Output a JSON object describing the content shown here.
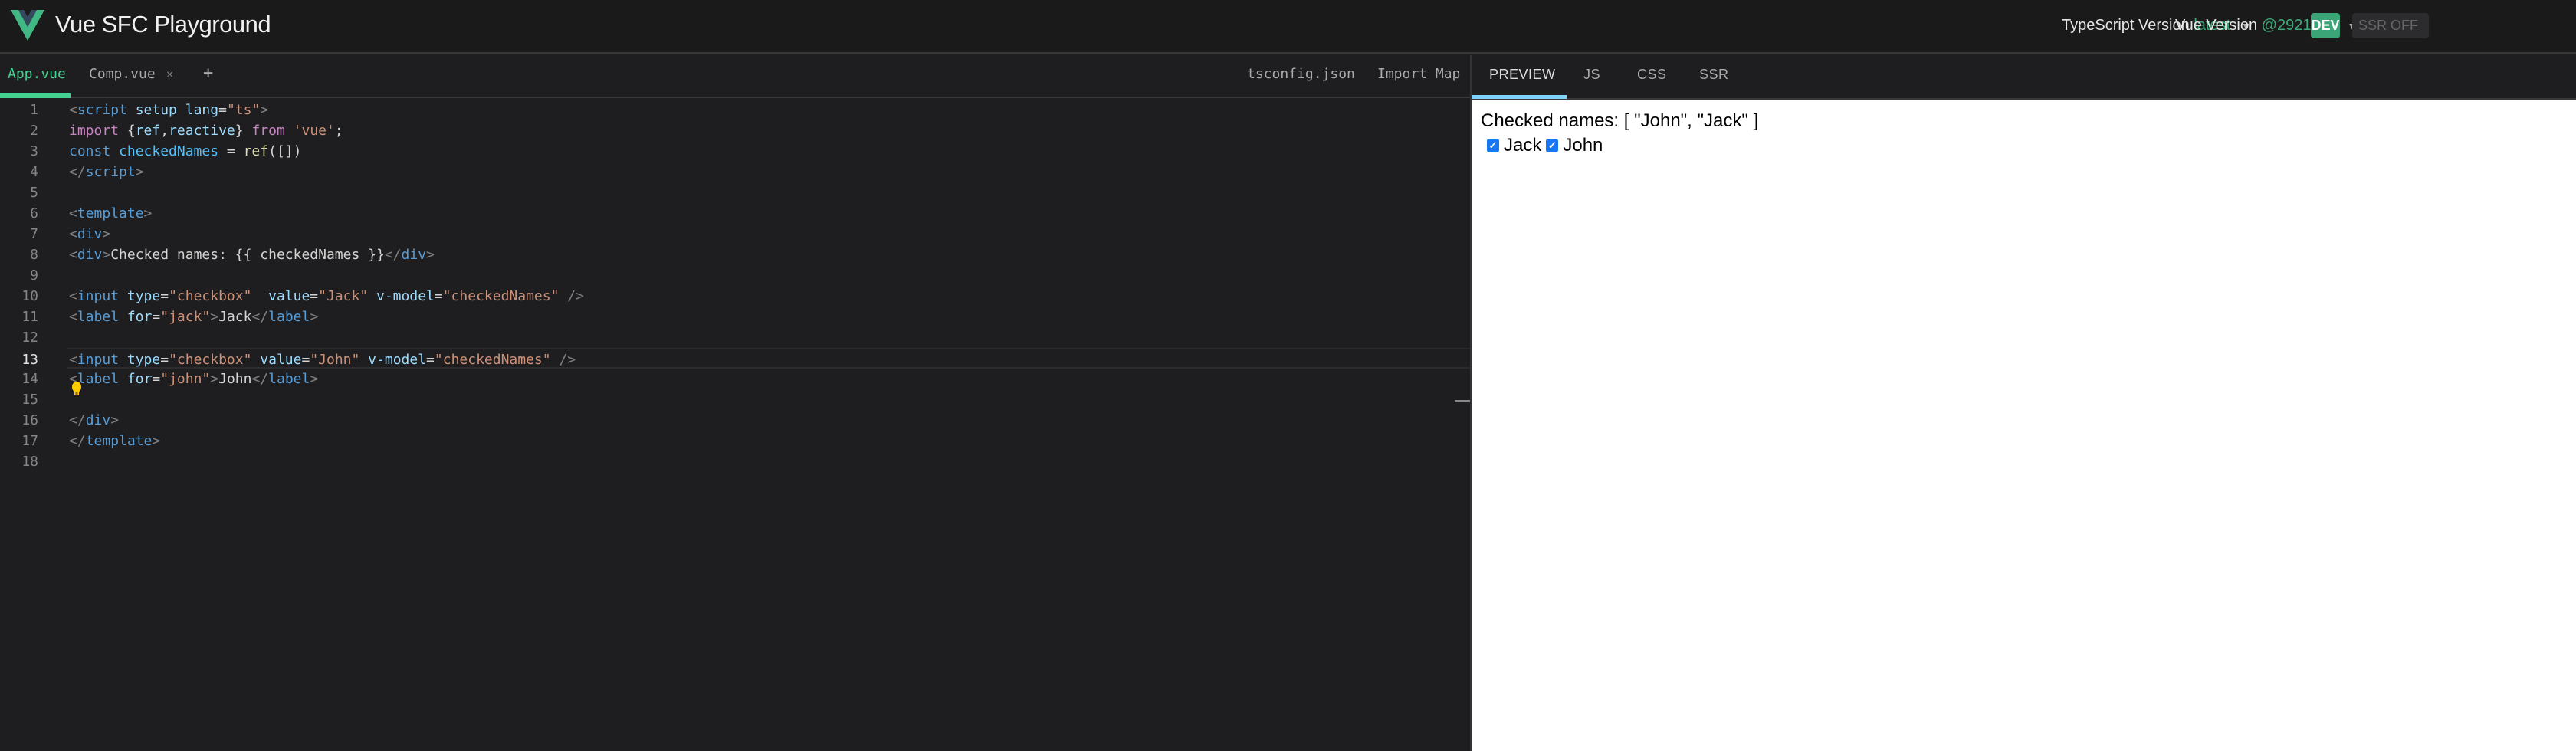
{
  "header": {
    "title": "Vue SFC Playground",
    "typescript_label": "TypeScript Version",
    "typescript_version": "latest",
    "vue_label": "Vue Version",
    "vue_version": "@2921685",
    "dev_badge": "DEV",
    "ssr_toggle": "SSR OFF",
    "accent": "#42d392"
  },
  "editor": {
    "tabs": [
      {
        "label": "App.vue",
        "active": true
      },
      {
        "label": "Comp.vue",
        "closable": true
      }
    ],
    "close_icon": "×",
    "add_tab": "+",
    "right_tabs": [
      "tsconfig.json",
      "Import Map"
    ],
    "current_line": 13,
    "lines": [
      [
        [
          "<",
          "br"
        ],
        [
          "script",
          "tag"
        ],
        [
          " setup",
          "attr"
        ],
        [
          " lang",
          "attr"
        ],
        [
          "=",
          "txt"
        ],
        [
          "\"ts\"",
          "str"
        ],
        [
          ">",
          "br"
        ]
      ],
      [
        [
          "import",
          "kw"
        ],
        [
          " {",
          "txt"
        ],
        [
          "ref",
          "attr"
        ],
        [
          ",",
          "txt"
        ],
        [
          "reactive",
          "attr"
        ],
        [
          "} ",
          "txt"
        ],
        [
          "from",
          "kw"
        ],
        [
          " 'vue'",
          "str"
        ],
        [
          ";",
          "txt"
        ]
      ],
      [
        [
          "const",
          "kw2"
        ],
        [
          " checkedNames",
          "var"
        ],
        [
          " = ",
          "txt"
        ],
        [
          "ref",
          "fn"
        ],
        [
          "([])",
          "txt"
        ]
      ],
      [
        [
          "</",
          "br"
        ],
        [
          "script",
          "tag"
        ],
        [
          ">",
          "br"
        ]
      ],
      [],
      [
        [
          "<",
          "br"
        ],
        [
          "template",
          "tag"
        ],
        [
          ">",
          "br"
        ]
      ],
      [
        [
          "<",
          "br"
        ],
        [
          "div",
          "tag"
        ],
        [
          ">",
          "br"
        ]
      ],
      [
        [
          "<",
          "br"
        ],
        [
          "div",
          "tag"
        ],
        [
          ">",
          "br"
        ],
        [
          "Checked names: {{ checkedNames }}",
          "txt"
        ],
        [
          "</",
          "br"
        ],
        [
          "div",
          "tag"
        ],
        [
          ">",
          "br"
        ]
      ],
      [],
      [
        [
          "<",
          "br"
        ],
        [
          "input",
          "tag"
        ],
        [
          " type",
          "attr"
        ],
        [
          "=",
          "txt"
        ],
        [
          "\"checkbox\"",
          "str"
        ],
        [
          "  value",
          "attr"
        ],
        [
          "=",
          "txt"
        ],
        [
          "\"Jack\"",
          "str"
        ],
        [
          " v-model",
          "attr"
        ],
        [
          "=",
          "txt"
        ],
        [
          "\"checkedNames\"",
          "str"
        ],
        [
          " />",
          "br"
        ]
      ],
      [
        [
          "<",
          "br"
        ],
        [
          "label",
          "tag"
        ],
        [
          " for",
          "attr"
        ],
        [
          "=",
          "txt"
        ],
        [
          "\"jack\"",
          "str"
        ],
        [
          ">",
          "br"
        ],
        [
          "Jack",
          "txt"
        ],
        [
          "</",
          "br"
        ],
        [
          "label",
          "tag"
        ],
        [
          ">",
          "br"
        ]
      ],
      [],
      [
        [
          "<",
          "br"
        ],
        [
          "input",
          "tag"
        ],
        [
          " type",
          "attr"
        ],
        [
          "=",
          "txt"
        ],
        [
          "\"checkbox\"",
          "str"
        ],
        [
          " value",
          "attr"
        ],
        [
          "=",
          "txt"
        ],
        [
          "\"John\"",
          "str"
        ],
        [
          " v-model",
          "attr"
        ],
        [
          "=",
          "txt"
        ],
        [
          "\"checkedNames\"",
          "str"
        ],
        [
          " />",
          "br"
        ]
      ],
      [
        [
          "<",
          "br"
        ],
        [
          "label",
          "tag"
        ],
        [
          " for",
          "attr"
        ],
        [
          "=",
          "txt"
        ],
        [
          "\"john\"",
          "str"
        ],
        [
          ">",
          "br"
        ],
        [
          "John",
          "txt"
        ],
        [
          "</",
          "br"
        ],
        [
          "label",
          "tag"
        ],
        [
          ">",
          "br"
        ]
      ],
      [],
      [
        [
          "</",
          "br"
        ],
        [
          "div",
          "tag"
        ],
        [
          ">",
          "br"
        ]
      ],
      [
        [
          "</",
          "br"
        ],
        [
          "template",
          "tag"
        ],
        [
          ">",
          "br"
        ]
      ],
      []
    ]
  },
  "preview": {
    "tabs": [
      "PREVIEW",
      "JS",
      "CSS",
      "SSR"
    ],
    "active_tab": "PREVIEW",
    "output_text": "Checked names: [ \"John\", \"Jack\" ]",
    "checkboxes": [
      {
        "label": "Jack",
        "checked": true
      },
      {
        "label": "John",
        "checked": true
      }
    ]
  }
}
